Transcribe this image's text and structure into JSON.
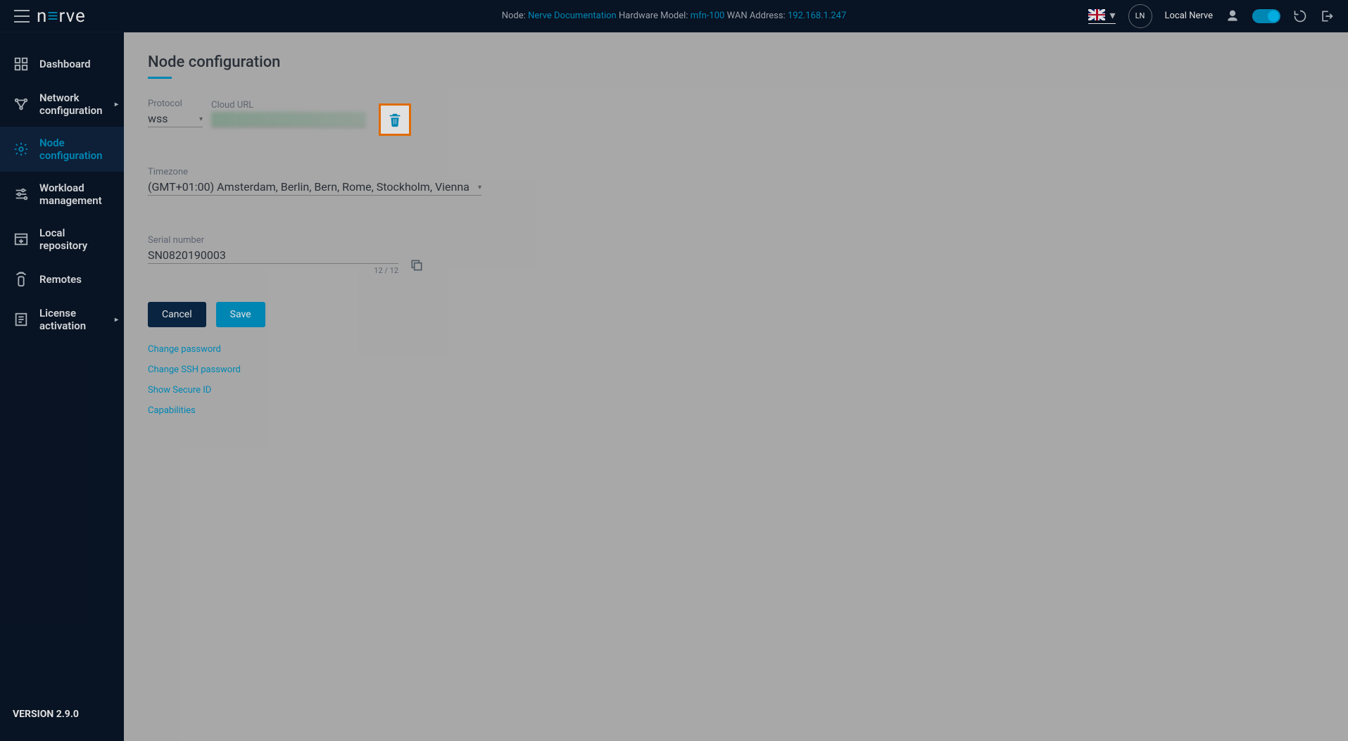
{
  "header": {
    "node_label": "Node:",
    "node_value": "Nerve Documentation",
    "hw_label": "Hardware Model:",
    "hw_value": "mfn-100",
    "wan_label": "WAN Address:",
    "wan_value": "192.168.1.247",
    "ln_badge": "LN",
    "local_nerve": "Local Nerve"
  },
  "sidebar": {
    "items": [
      {
        "label": "Dashboard"
      },
      {
        "label": "Network configuration"
      },
      {
        "label": "Node configuration"
      },
      {
        "label": "Workload management"
      },
      {
        "label": "Local repository"
      },
      {
        "label": "Remotes"
      },
      {
        "label": "License activation"
      }
    ],
    "version": "VERSION 2.9.0"
  },
  "page": {
    "title": "Node configuration",
    "protocol_label": "Protocol",
    "protocol_value": "wss",
    "cloud_url_label": "Cloud URL",
    "timezone_label": "Timezone",
    "timezone_value": "(GMT+01:00) Amsterdam, Berlin, Bern, Rome, Stockholm, Vienna",
    "serial_label": "Serial number",
    "serial_value": "SN0820190003",
    "serial_count": "12 / 12",
    "cancel_btn": "Cancel",
    "save_btn": "Save",
    "links": [
      "Change password",
      "Change SSH password",
      "Show Secure ID",
      "Capabilities"
    ]
  }
}
